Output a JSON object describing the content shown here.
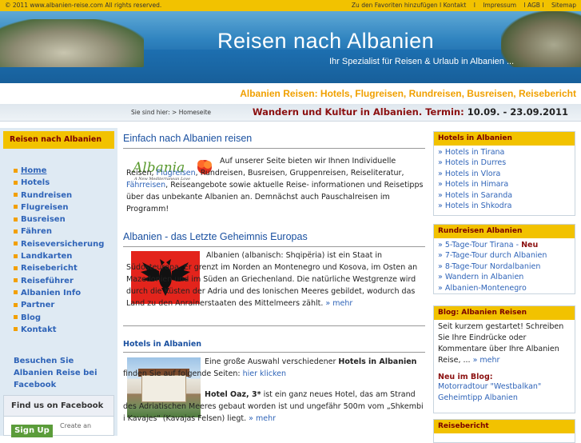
{
  "topbar": {
    "copyright": "© 2011 www.albanien-reise.com All rights reserved.",
    "links": [
      "Zu den Favoriten hinzufügen I Kontakt",
      "I",
      "Impressum",
      "I AGB I",
      "Sitemap"
    ]
  },
  "banner": {
    "title": "Reisen nach Albanien",
    "subtitle": "Ihr Spezialist für Reisen & Urlaub in Albanien ..."
  },
  "tagline": "Albanien Reisen: Hotels, Flugreisen, Rundreisen, Busreisen, Reisebericht",
  "breadcrumb": {
    "path": "Sie sind hier: > Homeseite",
    "event": "Wandern und Kultur  in Albanien. Termin: ",
    "date": "10.09. - 23.09.2011"
  },
  "sidebar": {
    "heading": "Reisen nach Albanien",
    "items": [
      {
        "label": "Home"
      },
      {
        "label": "Hotels"
      },
      {
        "label": "Rundreisen"
      },
      {
        "label": "Flugreisen"
      },
      {
        "label": "Busreisen"
      },
      {
        "label": "Fähren"
      },
      {
        "label": "Reiseversicherung"
      },
      {
        "label": "Landkarten"
      },
      {
        "label": "Reisebericht"
      },
      {
        "label": "Reiseführer"
      },
      {
        "label": "Albanien Info"
      },
      {
        "label": "Partner"
      },
      {
        "label": "Blog"
      },
      {
        "label": "Kontakt"
      }
    ],
    "facebook_link": "Besuchen Sie Albanien Reise bei Facebook",
    "facebook_box": {
      "title": "Find us on Facebook",
      "signup": "Sign Up",
      "create": "Create an"
    }
  },
  "main": {
    "sec1": {
      "title": "Einfach nach Albanien reisen",
      "logo_text": "Albania",
      "logo_sub": "A New Mediterranean Love",
      "t1": "Auf unserer Seite bieten wir Ihnen Individuelle Reisen, ",
      "l1": "Flugreisen",
      "t2": ", Rundreisen, Busreisen, Gruppenreisen, Reiseliteratur, ",
      "l2": "Fährreisen",
      "t3": ", Reiseangebote sowie aktuelle Reise- informationen und Reisetipps über das unbekante Albanien an. Demnächst auch Pauschalreisen im Programm!"
    },
    "sec2": {
      "title": "Albanien - das Letzte Geheimnis Europas",
      "text": "Albanien (albanisch: Shqipëria) ist ein Staat in Südosteuropa. Er grenzt im Norden an Montenegro und Kosova, im Osten an Mazedonien und im Süden an Griechenland. Die natürliche Westgrenze wird durch die Küsten der Adria und des Ionischen Meeres gebildet, wodurch das Land zu den Anrainerstaaten des Mittelmeers zählt.",
      "more": " » mehr"
    },
    "sec3": {
      "title": "Hotels in Albanien",
      "t1": "Eine große Auswahl verschiedener ",
      "b1": "Hotels in Albanien",
      "t2": " finden Sie auf folgende Seiten: ",
      "l1": "hier klicken",
      "b2": "Hotel Oaz, 3*",
      "t3": " ist ein ganz neues Hotel, das am Strand des Adriatischen Meeres gebaut worden ist und ungefähr 500m vom „Shkembi i Kavajes\" (Kavajas Felsen) liegt.",
      "more": " » mehr"
    }
  },
  "right": {
    "hotels": {
      "heading": "Hotels in Albanien",
      "items": [
        "» Hotels in Tirana",
        "» Hotels in Durres",
        "» Hotels in Vlora",
        "» Hotels in Himara",
        "» Hotels in Saranda",
        "» Hotels in Shkodra"
      ]
    },
    "rundreisen": {
      "heading": "Rundreisen Albanien",
      "items": [
        "» 5-Tage-Tour Tirana - ",
        "» 7-Tage-Tour durch Albanien",
        "» 8-Tage-Tour Nordalbanien",
        "» Wandern in Albanien",
        "» Albanien-Montenegro"
      ],
      "neu": "Neu"
    },
    "blog": {
      "heading": "Blog: Albanien Reisen",
      "text": "Seit kurzem gestartet! Schreiben Sie Ihre Eindrücke oder Kommentare über Ihre Albanien Reise, ... ",
      "more": "» mehr",
      "new_label": "Neu im Blog:",
      "links": [
        "Motorradtour \"Westbalkan\"",
        "Geheimtipp Albanien"
      ]
    },
    "reisebericht": {
      "heading": "Reisebericht"
    }
  },
  "colors": {
    "yellow": "#f2c200",
    "link_blue": "#2f64b8",
    "heading_blue": "#1a50a0",
    "dark_red": "#8b1010",
    "orange": "#f0a000"
  }
}
